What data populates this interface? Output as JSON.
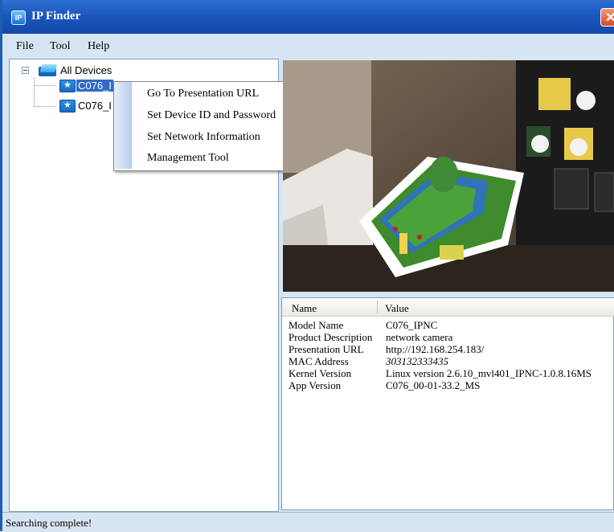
{
  "window": {
    "title": "IP Finder",
    "icon_label": "IP"
  },
  "menubar": {
    "items": [
      "File",
      "Tool",
      "Help"
    ]
  },
  "tree": {
    "root_label": "All Devices",
    "devices": [
      "C076_I",
      "C076_I"
    ]
  },
  "context_menu": {
    "items": [
      "Go To Presentation URL",
      "Set Device ID and Password",
      "Set Network Information",
      "Management Tool"
    ]
  },
  "properties": {
    "header_name": "Name",
    "header_value": "Value",
    "rows": [
      {
        "name": "Model Name",
        "value": "C076_IPNC"
      },
      {
        "name": "Product Description",
        "value": "network camera"
      },
      {
        "name": "Presentation URL",
        "value": "http://192.168.254.183/"
      },
      {
        "name": "MAC Address",
        "value": "303132333435"
      },
      {
        "name": "Kernel Version",
        "value": "Linux version 2.6.10_mvl401_IPNC-1.0.8.16MS"
      },
      {
        "name": "App Version",
        "value": "C076_00-01-33.2_MS"
      }
    ]
  },
  "status": {
    "text": "Searching complete!"
  },
  "colors": {
    "titlebar": "#1c57bd",
    "selection": "#316ac5",
    "background": "#d7e6f4"
  }
}
